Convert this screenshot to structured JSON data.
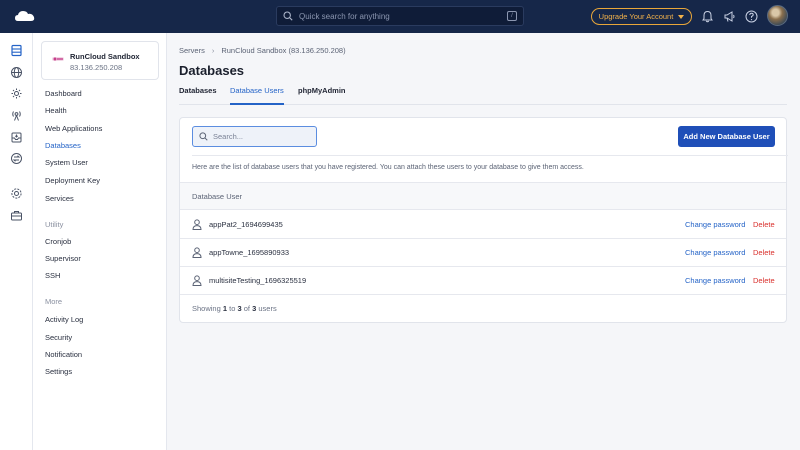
{
  "topbar": {
    "search_placeholder": "Quick search for anything",
    "search_shortcut": "/",
    "upgrade_label": "Upgrade Your Account"
  },
  "server": {
    "name": "RunCloud Sandbox",
    "ip": "83.136.250.208"
  },
  "sidebar": {
    "items": [
      {
        "label": "Dashboard"
      },
      {
        "label": "Health"
      },
      {
        "label": "Web Applications"
      },
      {
        "label": "Databases"
      },
      {
        "label": "System User"
      },
      {
        "label": "Deployment Key"
      },
      {
        "label": "Services"
      }
    ],
    "utility_heading": "Utility",
    "utility_items": [
      {
        "label": "Cronjob"
      },
      {
        "label": "Supervisor"
      },
      {
        "label": "SSH"
      }
    ],
    "more_heading": "More",
    "more_items": [
      {
        "label": "Activity Log"
      },
      {
        "label": "Security"
      },
      {
        "label": "Notification"
      },
      {
        "label": "Settings"
      }
    ]
  },
  "breadcrumb": {
    "root": "Servers",
    "current": "RunCloud Sandbox (83.136.250.208)"
  },
  "page": {
    "title": "Databases",
    "tabs": [
      {
        "label": "Databases"
      },
      {
        "label": "Database Users"
      },
      {
        "label": "phpMyAdmin"
      }
    ]
  },
  "card": {
    "search_placeholder": "Search...",
    "add_button": "Add New Database User",
    "description": "Here are the list of database users that you have registered. You can attach these users to your database to give them access.",
    "column_header": "Database User",
    "rows": [
      {
        "name": "appPat2_1694699435",
        "change": "Change password",
        "delete": "Delete"
      },
      {
        "name": "appTowne_1695890933",
        "change": "Change password",
        "delete": "Delete"
      },
      {
        "name": "multisiteTesting_1696325519",
        "change": "Change password",
        "delete": "Delete"
      }
    ],
    "footer": {
      "prefix": "Showing",
      "from": "1",
      "to_word": "to",
      "to": "3",
      "of_word": "of",
      "total": "3",
      "suffix": "users"
    }
  },
  "colors": {
    "topbar": "#162749",
    "accent": "#2463c7",
    "primary_button": "#1f4fb8",
    "danger": "#d9302c",
    "upgrade": "#f3b24a"
  }
}
